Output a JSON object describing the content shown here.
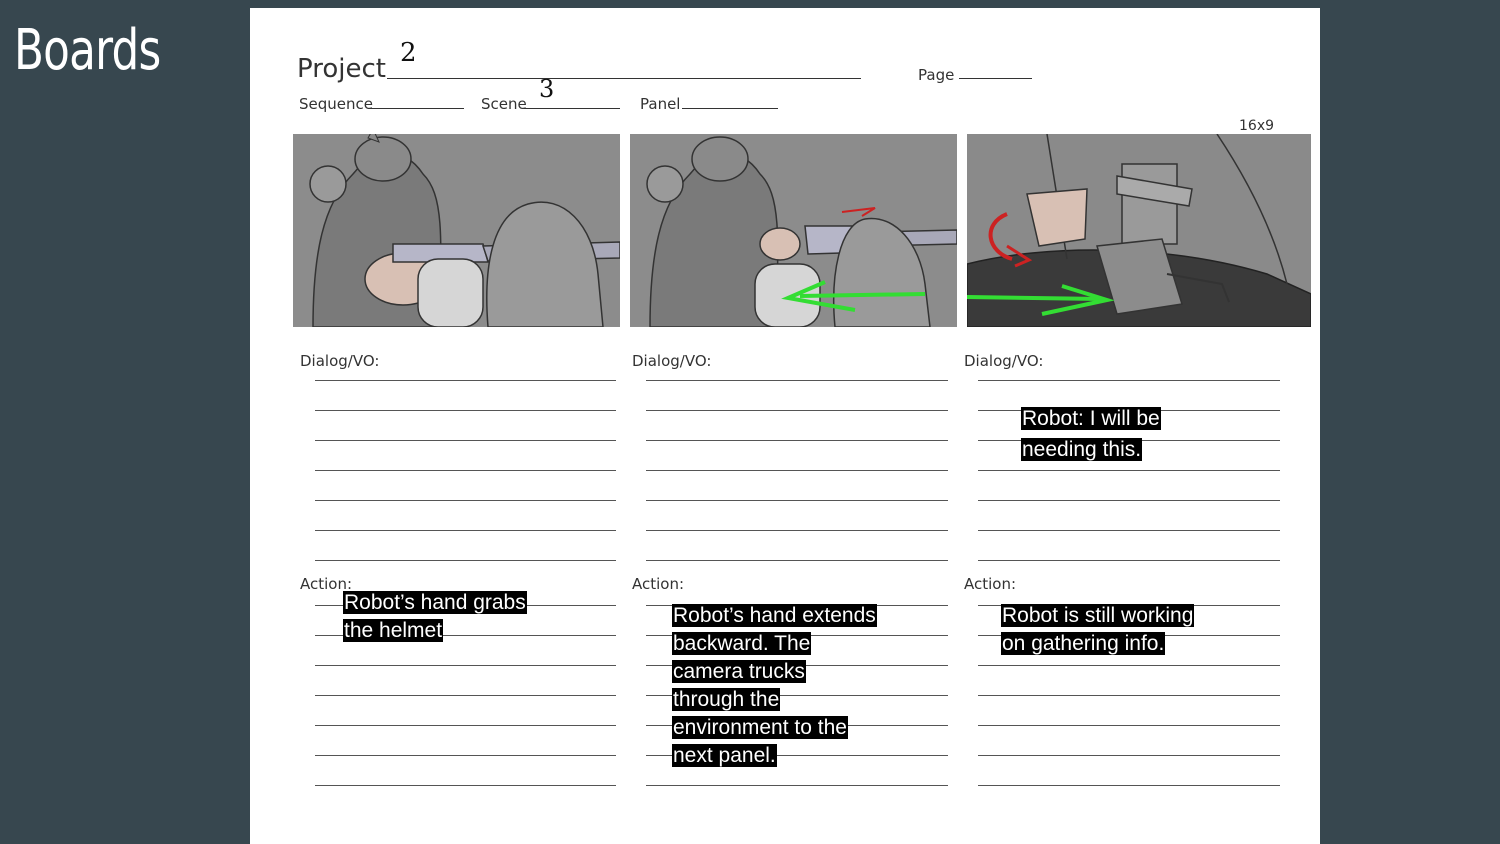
{
  "slide_title": "Boards",
  "header": {
    "project_label": "Project",
    "project_value": "2",
    "page_label": "Page",
    "sequence_label": "Sequence",
    "scene_label": "Scene",
    "scene_value": "3",
    "panel_label": "Panel",
    "aspect_label": "16x9"
  },
  "panels": [
    {
      "dialog_label": "Dialog/VO:",
      "dialog_text": [
        "",
        ""
      ],
      "action_label": "Action:",
      "action_text": [
        "Robot’s hand grabs",
        "the helmet"
      ]
    },
    {
      "dialog_label": "Dialog/VO:",
      "dialog_text": [
        "",
        ""
      ],
      "action_label": "Action:",
      "action_text": [
        "Robot’s hand extends",
        "backward. The",
        "camera trucks",
        "through the",
        "environment to the",
        "next panel."
      ]
    },
    {
      "dialog_label": "Dialog/VO:",
      "dialog_text": [
        "Robot: I will be",
        "needing this."
      ],
      "action_label": "Action:",
      "action_text": [
        "Robot is still working",
        "on gathering info."
      ]
    }
  ],
  "colors": {
    "background": "#37474f",
    "sheet": "#ffffff",
    "note_bg": "#000000",
    "arrow_green": "#33dd33",
    "arrow_red": "#cc2222"
  }
}
